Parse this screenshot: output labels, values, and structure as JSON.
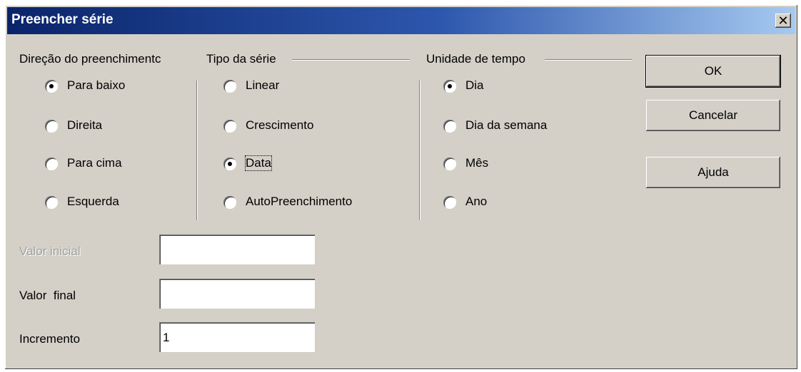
{
  "window": {
    "title": "Preencher série",
    "close_label": "✕"
  },
  "groups": {
    "direction": {
      "title": "Direção do preenchimentc",
      "options": [
        {
          "label": "Para baixo",
          "checked": true
        },
        {
          "label": "Direita",
          "checked": false
        },
        {
          "label": "Para cima",
          "checked": false
        },
        {
          "label": "Esquerda",
          "checked": false
        }
      ]
    },
    "series_type": {
      "title": "Tipo da série",
      "options": [
        {
          "label": "Linear",
          "checked": false
        },
        {
          "label": "Crescimento",
          "checked": false
        },
        {
          "label": "Data",
          "checked": true
        },
        {
          "label": "AutoPreenchimento",
          "checked": false
        }
      ]
    },
    "time_unit": {
      "title": "Unidade de tempo",
      "options": [
        {
          "label": "Dia",
          "checked": true
        },
        {
          "label": "Dia da semana",
          "checked": false
        },
        {
          "label": "Mês",
          "checked": false
        },
        {
          "label": "Ano",
          "checked": false
        }
      ]
    }
  },
  "fields": {
    "start_value": {
      "label": "Valor inicial",
      "value": "",
      "disabled": true
    },
    "end_value": {
      "label": "Valor  final",
      "value": ""
    },
    "increment": {
      "label": "Incremento",
      "value": "1"
    }
  },
  "buttons": {
    "ok": "OK",
    "cancel": "Cancelar",
    "help": "Ajuda"
  }
}
